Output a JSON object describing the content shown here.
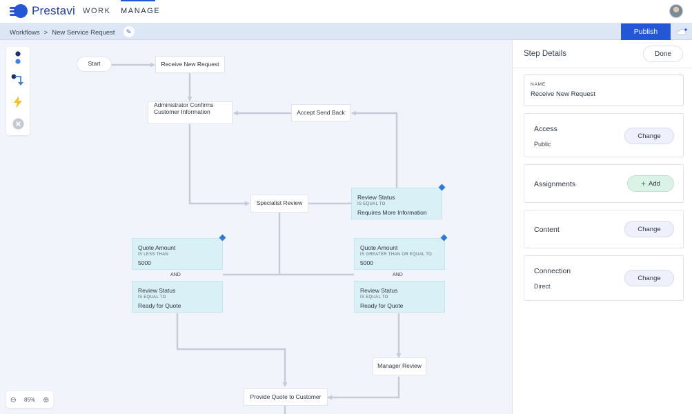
{
  "app": {
    "name": "Prestavi",
    "brand_color": "#2457d6",
    "nav": [
      {
        "label": "WORK",
        "active": false
      },
      {
        "label": "MANAGE",
        "active": true
      }
    ]
  },
  "breadcrumb": {
    "root": "Workflows",
    "separator": ">",
    "current": "New Service Request"
  },
  "toolbar": {
    "publish_label": "Publish"
  },
  "canvas": {
    "zoom": "85%",
    "tools": [
      "steps-tool-icon",
      "connection-tool-icon",
      "automation-bolt-icon",
      "remove-x-icon"
    ],
    "nodes": {
      "start": "Start",
      "receive": "Receive New Request",
      "admin_confirm_1": "Administrator Confirms",
      "admin_confirm_2": "Customer Information",
      "accept_send_back": "Accept Send Back",
      "specialist_review": "Specialist Review",
      "manager_review": "Manager Review",
      "provide_quote": "Provide Quote to Customer"
    },
    "conditions": {
      "review_more_info": {
        "field": "Review Status",
        "op": "IS EQUAL TO",
        "value": "Requires More Information"
      },
      "quote_less": {
        "field": "Quote Amount",
        "op": "IS LESS THAN",
        "value": "5000"
      },
      "review_ready_left": {
        "field": "Review Status",
        "op": "IS EQUAL TO",
        "value": "Ready for Quote"
      },
      "quote_gte": {
        "field": "Quote Amount",
        "op": "IS GREATER THAN OR EQUAL TO",
        "value": "5000"
      },
      "review_ready_right": {
        "field": "Review Status",
        "op": "IS EQUAL TO",
        "value": "Ready for Quote"
      }
    },
    "and_label": "AND"
  },
  "panel": {
    "title": "Step Details",
    "done_label": "Done",
    "name_label": "NAME",
    "name_value": "Receive New Request",
    "cards": {
      "access": {
        "title": "Access",
        "value": "Public",
        "action": "Change"
      },
      "assignments": {
        "title": "Assignments",
        "action": "Add"
      },
      "content": {
        "title": "Content",
        "action": "Change"
      },
      "connection": {
        "title": "Connection",
        "value": "Direct",
        "action": "Change"
      }
    }
  }
}
